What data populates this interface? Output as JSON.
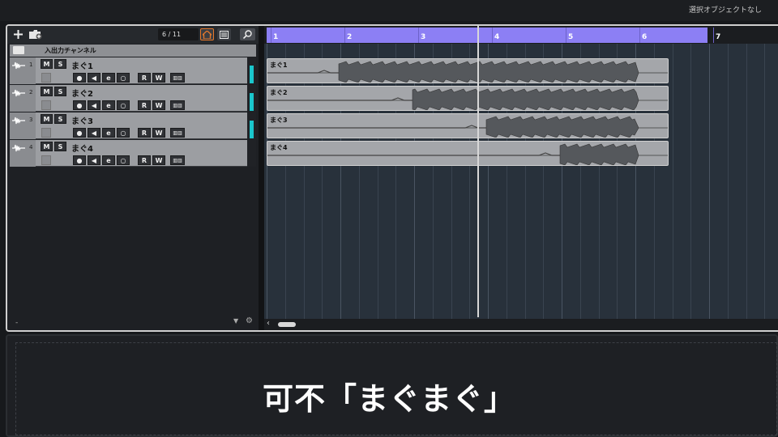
{
  "status_bar": {
    "text": "選択オブジェクトなし"
  },
  "track_list": {
    "counter": "6 / 11",
    "io_channel_label": "入出力チャンネル",
    "footer_dash": "-",
    "tracks": [
      {
        "number": "1",
        "name": "まぐ1",
        "mute": "M",
        "solo": "S",
        "read": "R",
        "write": "W"
      },
      {
        "number": "2",
        "name": "まぐ2",
        "mute": "M",
        "solo": "S",
        "read": "R",
        "write": "W"
      },
      {
        "number": "3",
        "name": "まぐ3",
        "mute": "M",
        "solo": "S",
        "read": "R",
        "write": "W"
      },
      {
        "number": "4",
        "name": "まぐ4",
        "mute": "M",
        "solo": "S",
        "read": "R",
        "write": "W"
      }
    ]
  },
  "ruler": {
    "bars": [
      "1",
      "2",
      "3",
      "4",
      "5",
      "6",
      "7"
    ]
  },
  "events": [
    {
      "name": "まぐ1"
    },
    {
      "name": "まぐ2"
    },
    {
      "name": "まぐ3"
    },
    {
      "name": "まぐ4"
    }
  ],
  "caption": "可不「まぐまぐ」",
  "colors": {
    "cycle": "#8c7ff4",
    "meter": "#1ac6cc",
    "home_border": "#e4782c"
  }
}
